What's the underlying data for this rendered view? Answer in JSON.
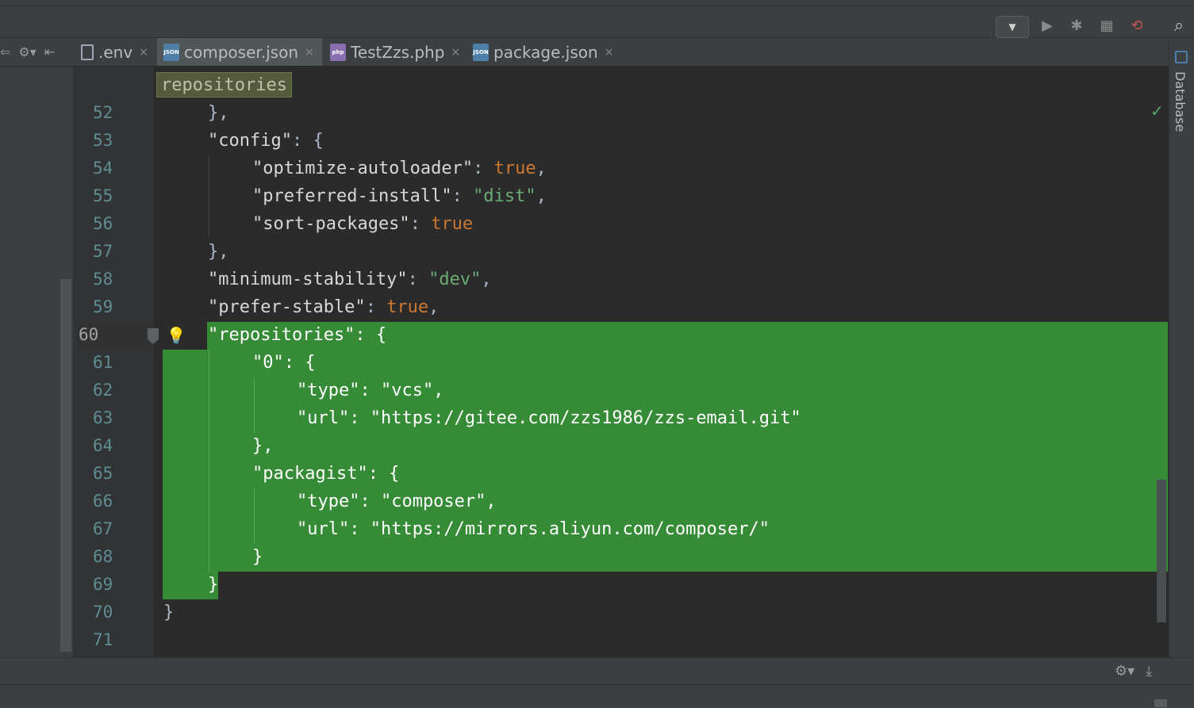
{
  "tabs": [
    {
      "label": ".env",
      "icon": "file-text-icon",
      "active": false
    },
    {
      "label": "composer.json",
      "icon": "json-file-icon",
      "active": true
    },
    {
      "label": "TestZzs.php",
      "icon": "php-file-icon",
      "active": false
    },
    {
      "label": "package.json",
      "icon": "json-file-icon",
      "active": false
    }
  ],
  "tab_icon_text": {
    "json": "JSON",
    "php": "php"
  },
  "close_glyph": "×",
  "breadcrumb": "repositories",
  "right_panel": {
    "database_label": "Database"
  },
  "toolbar": {
    "dropdown_glyph": "▼",
    "run_glyph": "▶",
    "debug_glyph": "✱",
    "coverage_glyph": "▦",
    "stop_glyph": "⟲",
    "search_glyph": "⌕"
  },
  "line_numbers": [
    "52",
    "53",
    "54",
    "55",
    "56",
    "57",
    "58",
    "59",
    "60",
    "61",
    "62",
    "63",
    "64",
    "65",
    "66",
    "67",
    "68",
    "69",
    "70",
    "71"
  ],
  "code": {
    "l52": "},",
    "l53_key": "\"config\"",
    "l53_rest": ": {",
    "l54_key": "\"optimize-autoloader\"",
    "l54_sep": ": ",
    "l54_val": "true",
    "l54_end": ",",
    "l55_key": "\"preferred-install\"",
    "l55_sep": ": ",
    "l55_val": "\"dist\"",
    "l55_end": ",",
    "l56_key": "\"sort-packages\"",
    "l56_sep": ": ",
    "l56_val": "true",
    "l57": "},",
    "l58_key": "\"minimum-stability\"",
    "l58_sep": ": ",
    "l58_val": "\"dev\"",
    "l58_end": ",",
    "l59_key": "\"prefer-stable\"",
    "l59_sep": ": ",
    "l59_val": "true",
    "l59_end": ",",
    "l60": "\"repositories\": {",
    "l61": "\"0\": {",
    "l62": "\"type\": \"vcs\",",
    "l63": "\"url\": \"https://gitee.com/zzs1986/zzs-email.git\"",
    "l64": "},",
    "l65": "\"packagist\": {",
    "l66": "\"type\": \"composer\",",
    "l67": "\"url\": \"https://mirrors.aliyun.com/composer/\"",
    "l68": "}",
    "l69": "}",
    "l70": "}"
  },
  "colors": {
    "selection": "#368b36",
    "keyword": "#cc7832",
    "string_value": "#6a8759",
    "editor_bg": "#2b2b2b"
  }
}
